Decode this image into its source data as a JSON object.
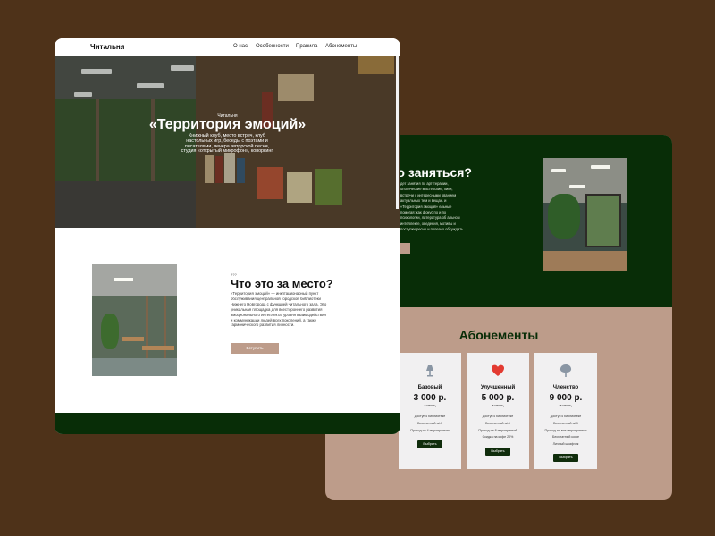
{
  "nav": {
    "brand": "Читальня",
    "links": [
      "О нас",
      "Особенности",
      "Правила",
      "Абонементы"
    ]
  },
  "hero": {
    "kicker": "Читальня",
    "title": "«Территория эмоций»",
    "description": "Книжный клуб, место встреч, клуб настольных игр, беседы с поэтами и писателями, вечера авторской песни, студия «открытый микрофон», коворкинг"
  },
  "about": {
    "kicker": "???",
    "title": "Что это за место?",
    "text": "«Территория эмоций» — инкптационарный пункт обслуживания центральной городской библиотеки Нижнего Новгорода с функцией читального зала. Это уникальная площадка для всестороннего развития эмоционального интеллекта, уровня взаимодействия и коммуникации людей всех поколений, а также гармонического развития личности.",
    "button": "Вступить"
  },
  "activities": {
    "heading": "жно заняться?",
    "text": "дет занятия по арт-терапии, ологические мастерские, пики, встречи с интересными ованием актуальных тем и вещах. и «Территория эмоций» ельные помогая: как фокус по и по психологии, литература об альном интеллекте, оведения, мотивы и поступки ресно и полезно обсуждать."
  },
  "subscriptions": {
    "title": "Абонементы",
    "plans": [
      {
        "icon": "lamp-icon",
        "name": "Базовый",
        "price": "3 000 р.",
        "period": "в месяц",
        "features": [
          "Доступ к библиотеке",
          "Бесплатный wi-fi",
          "Проход на 4 мероприятия"
        ],
        "button": "Выбрать"
      },
      {
        "icon": "heart-icon",
        "name": "Улучшенный",
        "price": "5 000 р.",
        "period": "в месяц",
        "features": [
          "Доступ к библиотеке",
          "Бесплатный wi-fi",
          "Проход на 8 мероприятий",
          "Скидка на кофе 20%"
        ],
        "button": "Выбрать"
      },
      {
        "icon": "tree-icon",
        "name": "Членство",
        "price": "9 000 р.",
        "period": "в месяц",
        "features": [
          "Доступ к библиотеке",
          "Бесплатный wi-fi",
          "Проход на все мероприятия",
          "Бесплатный кофе",
          "Личный шкафчик"
        ],
        "button": "Выбрать"
      }
    ]
  },
  "colors": {
    "background": "#4e3219",
    "dark_green": "#082d07",
    "accent": "#bd9c8a",
    "heart": "#e33a31"
  }
}
